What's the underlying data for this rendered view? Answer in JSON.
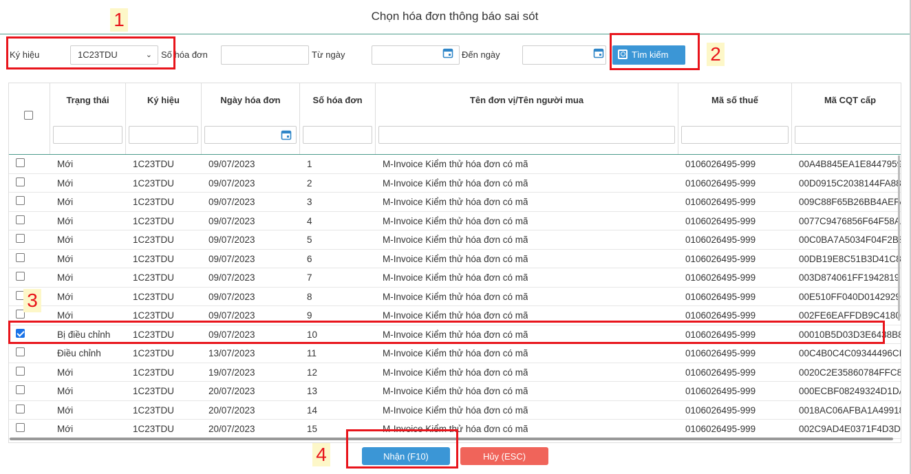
{
  "dialog": {
    "title": "Chọn hóa đơn thông báo sai sót"
  },
  "filters": {
    "symbol_label": "Ký hiệu",
    "symbol_value": "1C23TDU",
    "invoice_no_label": "Số hóa đơn",
    "invoice_no_value": "",
    "from_date_label": "Từ ngày",
    "from_date_value": "",
    "to_date_label": "Đến ngày",
    "to_date_value": "",
    "search_label": "Tìm kiếm"
  },
  "table": {
    "columns": [
      "Trạng thái",
      "Ký hiệu",
      "Ngày hóa đơn",
      "Số hóa đơn",
      "Tên đơn vị/Tên người mua",
      "Mã số thuế",
      "Mã CQT cấp"
    ],
    "rows": [
      {
        "status": "Mới",
        "symbol": "1C23TDU",
        "date": "09/07/2023",
        "number": "1",
        "buyer": "M-Invoice Kiểm thử hóa đơn có mã",
        "tax": "0106026495-999",
        "cqt": "00A4B845EA1E8447959",
        "checked": false
      },
      {
        "status": "Mới",
        "symbol": "1C23TDU",
        "date": "09/07/2023",
        "number": "2",
        "buyer": "M-Invoice Kiểm thử hóa đơn có mã",
        "tax": "0106026495-999",
        "cqt": "00D0915C2038144FA88",
        "checked": false
      },
      {
        "status": "Mới",
        "symbol": "1C23TDU",
        "date": "09/07/2023",
        "number": "3",
        "buyer": "M-Invoice Kiểm thử hóa đơn có mã",
        "tax": "0106026495-999",
        "cqt": "009C88F65B26BB4AEFA",
        "checked": false
      },
      {
        "status": "Mới",
        "symbol": "1C23TDU",
        "date": "09/07/2023",
        "number": "4",
        "buyer": "M-Invoice Kiểm thử hóa đơn có mã",
        "tax": "0106026495-999",
        "cqt": "0077C9476856F64F58A",
        "checked": false
      },
      {
        "status": "Mới",
        "symbol": "1C23TDU",
        "date": "09/07/2023",
        "number": "5",
        "buyer": "M-Invoice Kiểm thử hóa đơn có mã",
        "tax": "0106026495-999",
        "cqt": "00C0BA7A5034F04F2B8",
        "checked": false
      },
      {
        "status": "Mới",
        "symbol": "1C23TDU",
        "date": "09/07/2023",
        "number": "6",
        "buyer": "M-Invoice Kiểm thử hóa đơn có mã",
        "tax": "0106026495-999",
        "cqt": "00DB19E8C51B3D41C8",
        "checked": false
      },
      {
        "status": "Mới",
        "symbol": "1C23TDU",
        "date": "09/07/2023",
        "number": "7",
        "buyer": "M-Invoice Kiểm thử hóa đơn có mã",
        "tax": "0106026495-999",
        "cqt": "003D874061FF1942819",
        "checked": false
      },
      {
        "status": "Mới",
        "symbol": "1C23TDU",
        "date": "09/07/2023",
        "number": "8",
        "buyer": "M-Invoice Kiểm thử hóa đơn có mã",
        "tax": "0106026495-999",
        "cqt": "00E510FF040D0142929",
        "checked": false
      },
      {
        "status": "Mới",
        "symbol": "1C23TDU",
        "date": "09/07/2023",
        "number": "9",
        "buyer": "M-Invoice Kiểm thử hóa đơn có mã",
        "tax": "0106026495-999",
        "cqt": "002FE6EAFFDB9C4180",
        "checked": false
      },
      {
        "status": "Bị điều chỉnh",
        "symbol": "1C23TDU",
        "date": "09/07/2023",
        "number": "10",
        "buyer": "M-Invoice Kiểm thử hóa đơn có mã",
        "tax": "0106026495-999",
        "cqt": "00010B5D03D3E6438B8",
        "checked": true
      },
      {
        "status": "Điều chỉnh",
        "symbol": "1C23TDU",
        "date": "13/07/2023",
        "number": "11",
        "buyer": "M-Invoice Kiểm thử hóa đơn có mã",
        "tax": "0106026495-999",
        "cqt": "00C4B0C4C09344496CI",
        "checked": false
      },
      {
        "status": "Mới",
        "symbol": "1C23TDU",
        "date": "19/07/2023",
        "number": "12",
        "buyer": "M-Invoice Kiểm thử hóa đơn có mã",
        "tax": "0106026495-999",
        "cqt": "0020C2E35860784FFC8",
        "checked": false
      },
      {
        "status": "Mới",
        "symbol": "1C23TDU",
        "date": "20/07/2023",
        "number": "13",
        "buyer": "M-Invoice Kiểm thử hóa đơn có mã",
        "tax": "0106026495-999",
        "cqt": "000ECBF08249324D1DA",
        "checked": false
      },
      {
        "status": "Mới",
        "symbol": "1C23TDU",
        "date": "20/07/2023",
        "number": "14",
        "buyer": "M-Invoice Kiểm thử hóa đơn có mã",
        "tax": "0106026495-999",
        "cqt": "0018AC06AFBA1A49918",
        "checked": false
      },
      {
        "status": "Mới",
        "symbol": "1C23TDU",
        "date": "20/07/2023",
        "number": "15",
        "buyer": "M-Invoice Kiểm thử hóa đơn có mã",
        "tax": "0106026495-999",
        "cqt": "002C9AD4E0371F4D3D",
        "checked": false
      }
    ]
  },
  "footer": {
    "ok_label": "Nhận (F10)",
    "cancel_label": "Hủy (ESC)"
  },
  "annotations": [
    "1",
    "2",
    "3",
    "4"
  ],
  "colors": {
    "primary": "#3b96d6",
    "danger": "#f0645a",
    "annotation": "#e8141b"
  }
}
